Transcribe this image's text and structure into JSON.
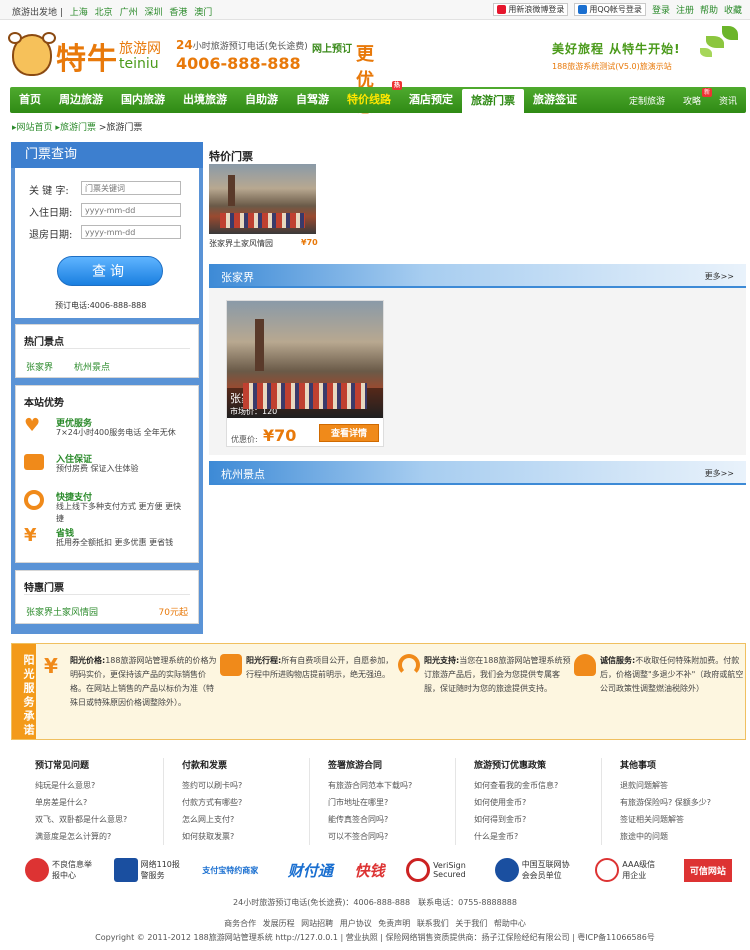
{
  "topbar": {
    "left_label": "旅游出发地",
    "cities": [
      "上海",
      "北京",
      "广州",
      "深圳",
      "香港",
      "澳门"
    ],
    "weibo_login": "用新浪微博登录",
    "qq_login": "用QQ帐号登录",
    "links": [
      "登录",
      "注册",
      "帮助",
      "收藏"
    ]
  },
  "header": {
    "brand_cn": "特牛",
    "brand_sub_cn": "旅游网",
    "brand_en": "teiniu",
    "hotline_label": "小时旅游预订电话(免长途费)",
    "hotline_hours": "24",
    "hotline_number": "4006-888-888",
    "promo_a": "网上预订",
    "promo_b": "更优惠",
    "slogan": "美好旅程 从特牛开始!",
    "slogan_sub": "188旅游系统测试(V5.0)旅演示站"
  },
  "nav": {
    "items": [
      "首页",
      "周边旅游",
      "国内旅游",
      "出境旅游",
      "自助游",
      "自驾游",
      "特价线路",
      "酒店预定",
      "旅游门票",
      "旅游签证"
    ],
    "hot_badge": "热",
    "right_items": [
      "定制旅游",
      "攻略",
      "资讯"
    ],
    "new_badge": "新"
  },
  "breadcrumb": {
    "home": "网站首页",
    "section": "旅游门票",
    "current": "旅游门票"
  },
  "query": {
    "title": "门票查询",
    "keyword_label": "关 键 字:",
    "keyword_placeholder": "门票关键词",
    "checkin_label": "入住日期:",
    "checkin_placeholder": "yyyy-mm-dd",
    "checkout_label": "退房日期:",
    "checkout_placeholder": "yyyy-mm-dd",
    "search_button": "查询",
    "phone": "预订电话:4006-888-888"
  },
  "hot_spots": {
    "title": "热门景点",
    "items": [
      "张家界",
      "杭州景点"
    ]
  },
  "advantages": {
    "title": "本站优势",
    "items": [
      {
        "h": "更优服务",
        "d": "7×24小时400服务电话 全年无休"
      },
      {
        "h": "入住保证",
        "d": "预付房费 保证入住体验"
      },
      {
        "h": "快捷支付",
        "d": "线上线下多种支付方式 更方便 更快捷"
      },
      {
        "h": "省钱",
        "d": "抵用券全额抵扣 更多优惠 更省钱"
      }
    ]
  },
  "special_tickets": {
    "title": "特惠门票",
    "name": "张家界土家风情园",
    "price": "70元起"
  },
  "featured": {
    "title": "特价门票",
    "name": "张家界土家风情园",
    "price": "¥70"
  },
  "section1": {
    "title": "张家界",
    "more": "更多>>",
    "card": {
      "name": "张家界土家风情园",
      "market": "市场价：120",
      "price_label": "优惠价:",
      "price": "¥70",
      "button": "查看详情"
    }
  },
  "section2": {
    "title": "杭州景点",
    "more": "更多>>"
  },
  "promise": {
    "side": "阳光服务承诺",
    "items": [
      {
        "h": "阳光价格:",
        "d": "188旅游网站管理系统的价格为明码实价，更保持该产品的实际销售价格。在网站上销售的产品以标价为准（特殊日或特殊原因价格调整除外）。"
      },
      {
        "h": "阳光行程:",
        "d": "所有自费项目公开，自愿参加，行程中所进购物店提前明示，绝无强迫。"
      },
      {
        "h": "阳光支持:",
        "d": "当您在188旅游网站管理系统预订旅游产品后，我们会为您提供专属客服，保证随时为您的旅途提供支持。"
      },
      {
        "h": "诚信服务:",
        "d": "不收取任何特殊附加费。付款后，价格调整\"多退少不补\"（政府或航空公司政策性调整燃油税除外）"
      }
    ]
  },
  "faq": [
    {
      "h": "预订常见问题",
      "items": [
        "纯玩是什么意思?",
        "单房差是什么?",
        "双飞、双卧都是什么意思?",
        "满意度是怎么计算的?"
      ]
    },
    {
      "h": "付款和发票",
      "items": [
        "签约可以刷卡吗?",
        "付款方式有哪些?",
        "怎么网上支付?",
        "如何获取发票?"
      ]
    },
    {
      "h": "签署旅游合同",
      "items": [
        "有旅游合同范本下载吗?",
        "门市地址在哪里?",
        "能传真签合同吗?",
        "可以不签合同吗?"
      ]
    },
    {
      "h": "旅游预订优惠政策",
      "items": [
        "如何查看我的金币信息?",
        "如何使用金币?",
        "如何得到金币?",
        "什么是金币?"
      ]
    },
    {
      "h": "其他事项",
      "items": [
        "退款问题解答",
        "有旅游保险吗? 保额多少?",
        "签证相关问题解答",
        "旅途中的问题"
      ]
    }
  ],
  "badges": [
    "不良信息举报中心",
    "网络110报警服务",
    "支付宝特约商家",
    "财付通",
    "快钱",
    "VeriSign Secured",
    "中国互联网协会会员单位",
    "AAA级信用企业",
    "可信网站"
  ],
  "footer": {
    "hotline": "24小时旅游预订电话(免长途费)：4006-888-888　联系电话：0755-8888888",
    "links": [
      "商务合作",
      "发展历程",
      "网站招聘",
      "用户协议",
      "免责声明",
      "联系我们",
      "关于我们",
      "帮助中心"
    ],
    "copyright": "Copyright © 2011-2012 188旅游网站管理系统 http://127.0.0.1 | 营业执照 | 保险网络销售资质提供商：扬子江保险经纪有限公司 | 粤ICP备11066586号"
  },
  "colors": {
    "green": "#2f8a15",
    "orange": "#e8790a",
    "blue": "#3d7fcf"
  }
}
